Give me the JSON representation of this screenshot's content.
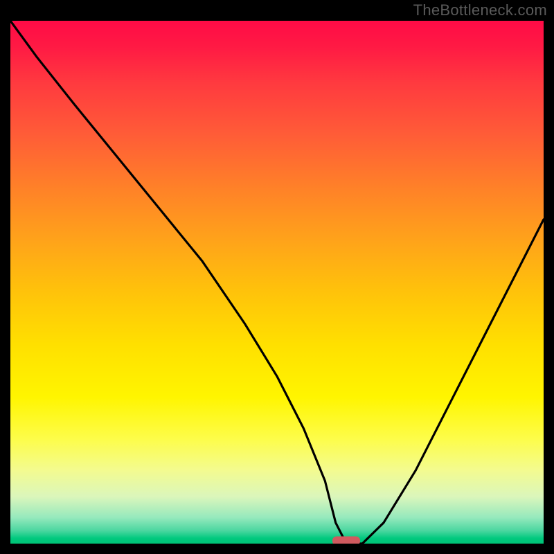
{
  "watermark": "TheBottleneck.com",
  "colors": {
    "background": "#000000",
    "curve": "#000000",
    "marker": "#d15a5f",
    "gradient_top": "#ff0b46",
    "gradient_bottom": "#00c375"
  },
  "chart_data": {
    "type": "line",
    "title": "",
    "xlabel": "",
    "ylabel": "",
    "xlim": [
      0,
      100
    ],
    "ylim": [
      0,
      100
    ],
    "grid": false,
    "legend": false,
    "series": [
      {
        "name": "bottleneck-curve",
        "x": [
          0,
          5,
          12,
          20,
          28,
          36,
          44,
          50,
          55,
          59,
          61,
          63,
          66,
          70,
          76,
          82,
          88,
          94,
          100
        ],
        "y": [
          100,
          93,
          84,
          74,
          64,
          54,
          42,
          32,
          22,
          12,
          4,
          0,
          0,
          4,
          14,
          26,
          38,
          50,
          62
        ]
      }
    ],
    "annotations": [
      {
        "name": "optimal-marker",
        "x": 63,
        "y": 0.5,
        "shape": "pill",
        "color": "#d15a5f"
      }
    ],
    "background_gradient": {
      "direction": "vertical",
      "stops": [
        {
          "pos": 0.0,
          "color": "#ff0b46"
        },
        {
          "pos": 0.3,
          "color": "#ff7a2d"
        },
        {
          "pos": 0.6,
          "color": "#ffe000"
        },
        {
          "pos": 0.85,
          "color": "#f3fb90"
        },
        {
          "pos": 1.0,
          "color": "#00c375"
        }
      ]
    }
  }
}
